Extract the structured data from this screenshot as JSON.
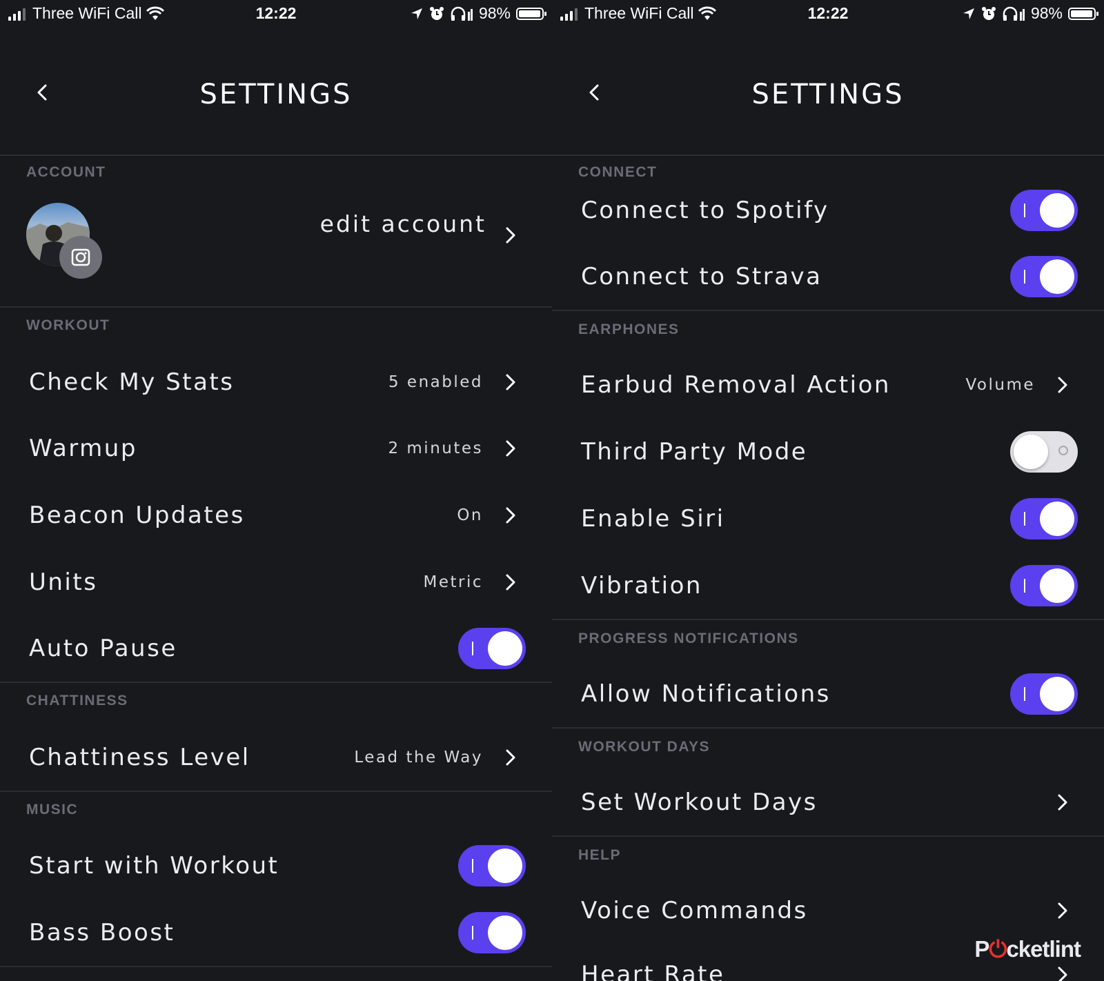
{
  "status_bar": {
    "carrier": "Three WiFi Call",
    "time": "12:22",
    "battery": "98%",
    "battery_level": 0.98
  },
  "left_screen": {
    "title": "SETTINGS",
    "account": {
      "section_label": "ACCOUNT",
      "edit_label": "edit account"
    },
    "workout": {
      "section_label": "WORKOUT",
      "rows": [
        {
          "label": "Check My Stats",
          "value": "5 enabled"
        },
        {
          "label": "Warmup",
          "value": "2 minutes"
        },
        {
          "label": "Beacon Updates",
          "value": "On"
        },
        {
          "label": "Units",
          "value": "Metric"
        },
        {
          "label": "Auto Pause",
          "toggle": true
        }
      ]
    },
    "chattiness": {
      "section_label": "CHATTINESS",
      "rows": [
        {
          "label": "Chattiness Level",
          "value": "Lead the Way"
        }
      ]
    },
    "music": {
      "section_label": "MUSIC",
      "rows": [
        {
          "label": "Start with Workout",
          "toggle": true
        },
        {
          "label": "Bass Boost",
          "toggle": true
        }
      ]
    }
  },
  "right_screen": {
    "title": "SETTINGS",
    "connect": {
      "section_label": "CONNECT",
      "rows": [
        {
          "label": "Connect to Spotify",
          "toggle": true
        },
        {
          "label": "Connect to Strava",
          "toggle": true
        }
      ]
    },
    "earphones": {
      "section_label": "EARPHONES",
      "rows": [
        {
          "label": "Earbud Removal Action",
          "value": "Volume"
        },
        {
          "label": "Third Party Mode",
          "toggle": false
        },
        {
          "label": "Enable Siri",
          "toggle": true
        },
        {
          "label": "Vibration",
          "toggle": true
        }
      ]
    },
    "progress": {
      "section_label": "PROGRESS NOTIFICATIONS",
      "rows": [
        {
          "label": "Allow Notifications",
          "toggle": true
        }
      ]
    },
    "workout_days": {
      "section_label": "WORKOUT DAYS",
      "rows": [
        {
          "label": "Set Workout Days"
        }
      ]
    },
    "help": {
      "section_label": "HELP",
      "rows": [
        {
          "label": "Voice Commands"
        },
        {
          "label": "Heart Rate"
        }
      ]
    }
  },
  "watermark": {
    "prefix": "P",
    "power_glyph": "⏻",
    "suffix": "cketlint"
  },
  "colors": {
    "background": "#18191d",
    "toggle_on": "#5a40ee",
    "toggle_off": "#e2e2e6",
    "section_label": "#6a6c76",
    "divider": "#2c2d33"
  }
}
